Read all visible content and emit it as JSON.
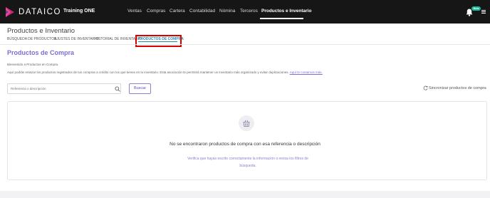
{
  "topbar": {
    "brand": "DATAICO",
    "company": "Training ONE",
    "nav": [
      "Ventas",
      "Compras",
      "Cartera",
      "Contabilidad",
      "Nómina",
      "Terceros",
      "Productos e Inventario"
    ],
    "active_nav": "Productos e Inventario",
    "new_badge": "New"
  },
  "header": {
    "title": "Productos e Inventario",
    "tabs": [
      "BÚSQUEDA DE PRODUCTOS",
      "AJUSTES DE INVENTARIO",
      "HISTORIAL DE INVENTARIO",
      "PRODUCTOS DE COMPRA"
    ],
    "active_tab": "PRODUCTOS DE COMPRA"
  },
  "section": {
    "title": "Productos de Compra",
    "welcome": "Bienvenido a Productos en Compra.",
    "description": "Aquí podrás enlazar los productos registrados de tus compras a crédito con los que tienes en tu inventario. Esta asociación te permitirá mantener un inventario más organizado y evitar duplicaciones.",
    "link": "Aquí te contamos más."
  },
  "search": {
    "placeholder": "Referencia o descripción",
    "button": "Buscar",
    "sync": "Sincronizar productos de compra"
  },
  "empty": {
    "title": "No se encontraron productos de compra con esa referencia o descripción",
    "subtitle": "Verifica que hayas escrito correctamente la información o revisa los filtros de búsqueda."
  },
  "colors": {
    "accent": "#7a6fd6",
    "tab_active": "#2b8ab0",
    "highlight": "#d80000",
    "badge": "#19b89b"
  }
}
